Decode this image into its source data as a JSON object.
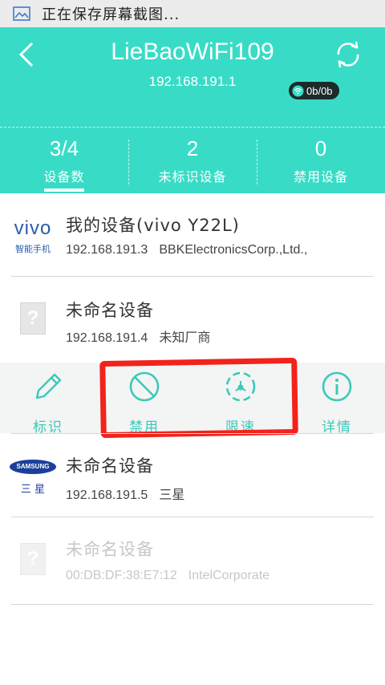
{
  "status_bar": {
    "text": "正在保存屏幕截图..."
  },
  "header": {
    "ssid": "LieBaoWiFi109",
    "ip": "192.168.191.1",
    "speed": "0b/0b",
    "accent_color": "#38dcc6"
  },
  "stats": [
    {
      "value": "3/4",
      "label": "设备数"
    },
    {
      "value": "2",
      "label": "未标识设备"
    },
    {
      "value": "0",
      "label": "禁用设备"
    }
  ],
  "devices": [
    {
      "brand": "vivo",
      "brand_sub": "智能手机",
      "name": "我的设备(vivo Y22L)",
      "ip": "192.168.191.3",
      "maker": "BBKElectronicsCorp.,Ltd.,"
    },
    {
      "name": "未命名设备",
      "ip": "192.168.191.4",
      "maker": "未知厂商"
    },
    {
      "brand": "SAMSUNG",
      "brand_sub": "三 星",
      "name": "未命名设备",
      "ip": "192.168.191.5",
      "maker": "三星"
    },
    {
      "name": "未命名设备",
      "ip": "00:DB:DF:38:E7:12",
      "maker": "IntelCorporate"
    }
  ],
  "actions": [
    {
      "label": "标识",
      "icon": "pencil-icon"
    },
    {
      "label": "禁用",
      "icon": "ban-icon"
    },
    {
      "label": "限速",
      "icon": "speed-limit-icon"
    },
    {
      "label": "详情",
      "icon": "info-icon"
    }
  ]
}
